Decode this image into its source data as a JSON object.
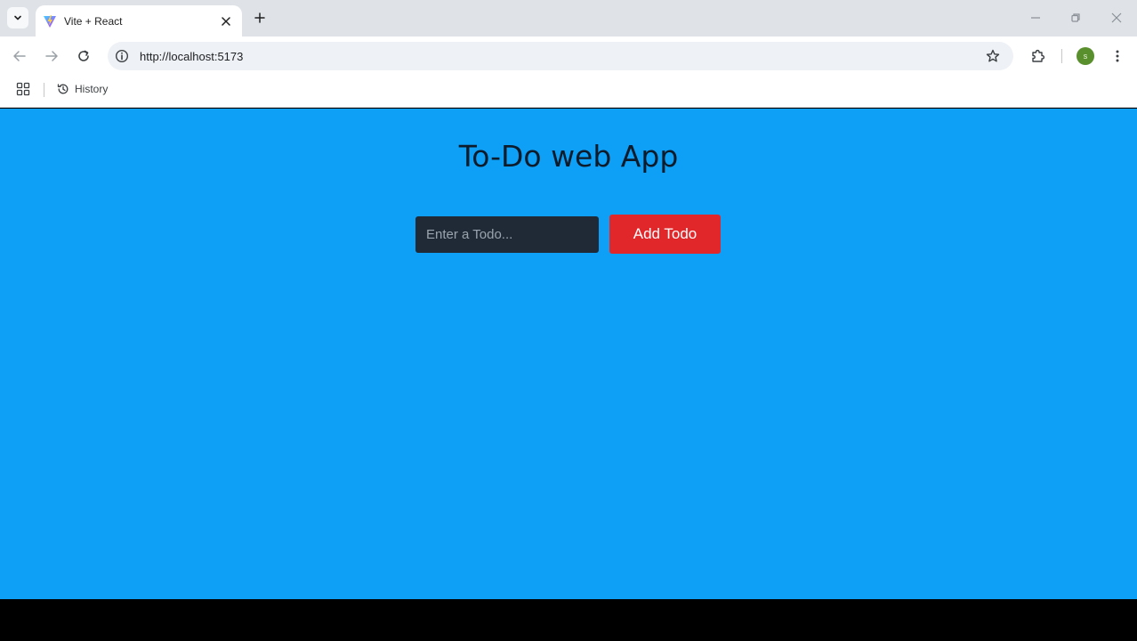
{
  "browser": {
    "tab": {
      "title": "Vite + React"
    },
    "omnibox": {
      "url": "http://localhost:5173"
    },
    "profile": {
      "initial": "s"
    },
    "bookmarks": [
      {
        "label": "History",
        "icon": "history-icon"
      }
    ]
  },
  "app": {
    "title": "To-Do web App",
    "input": {
      "value": "",
      "placeholder": "Enter a Todo..."
    },
    "add_button_label": "Add Todo"
  },
  "colors": {
    "page_background": "#0ea0f7",
    "input_background": "#1f2a36",
    "button_background": "#e2272b",
    "title_color": "#0d1b2a"
  }
}
